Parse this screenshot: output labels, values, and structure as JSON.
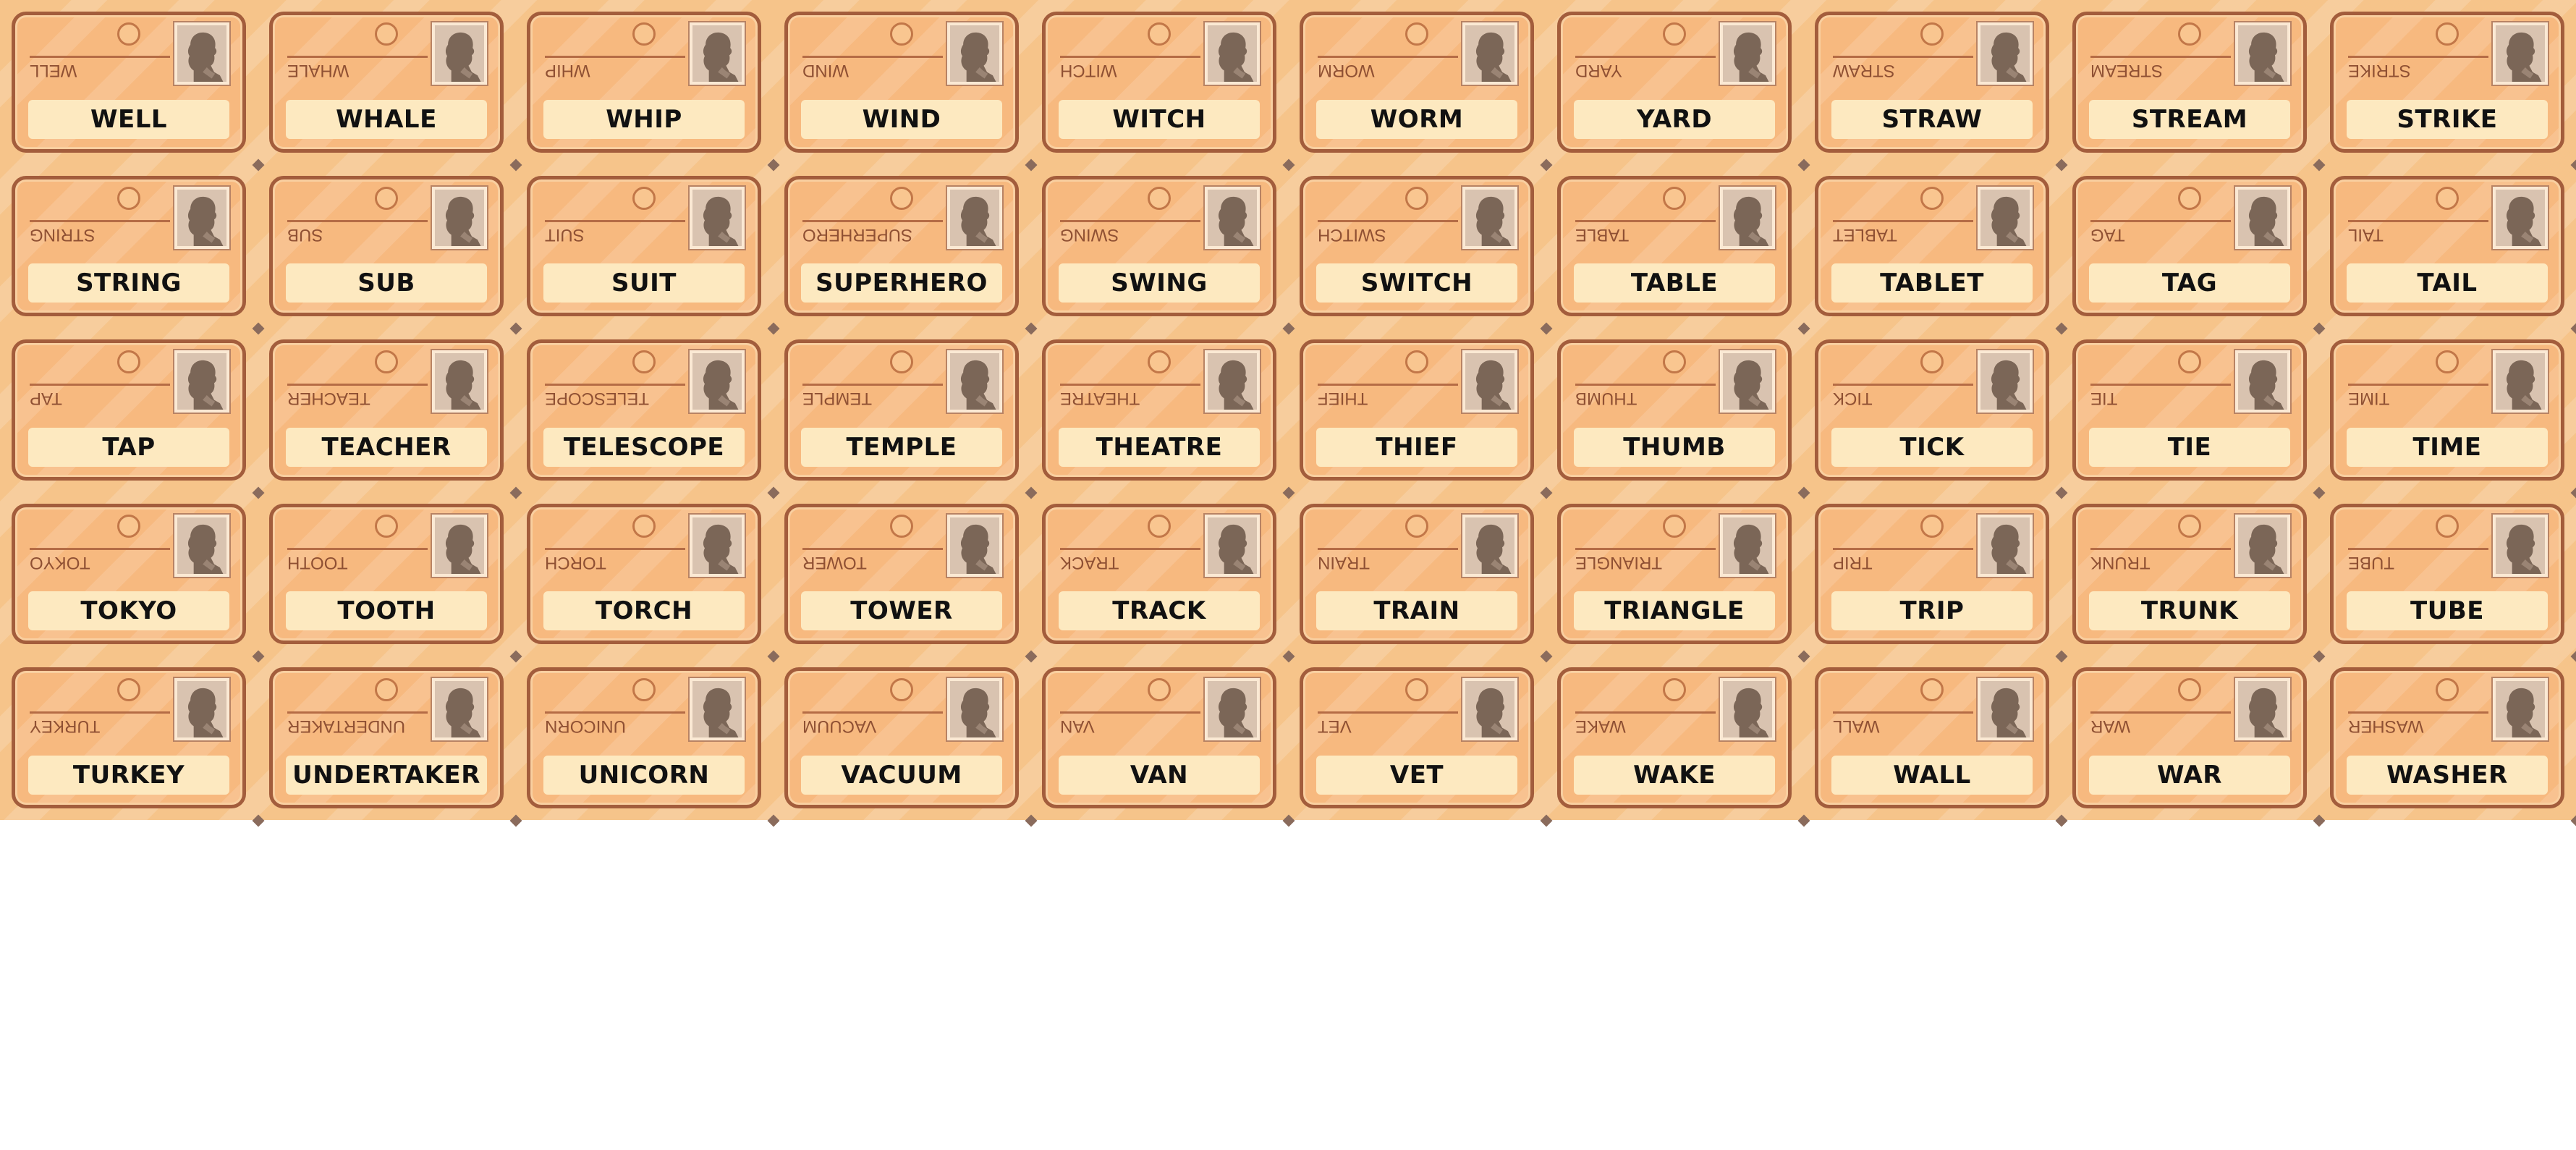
{
  "cards": [
    {
      "word": "WELL"
    },
    {
      "word": "WHALE"
    },
    {
      "word": "WHIP"
    },
    {
      "word": "WIND"
    },
    {
      "word": "WITCH"
    },
    {
      "word": "WORM"
    },
    {
      "word": "YARD"
    },
    {
      "word": "STRAW"
    },
    {
      "word": "STREAM"
    },
    {
      "word": "STRIKE"
    },
    {
      "word": "STRING"
    },
    {
      "word": "SUB"
    },
    {
      "word": "SUIT"
    },
    {
      "word": "SUPERHERO"
    },
    {
      "word": "SWING"
    },
    {
      "word": "SWITCH"
    },
    {
      "word": "TABLE"
    },
    {
      "word": "TABLET"
    },
    {
      "word": "TAG"
    },
    {
      "word": "TAIL"
    },
    {
      "word": "TAP"
    },
    {
      "word": "TEACHER"
    },
    {
      "word": "TELESCOPE"
    },
    {
      "word": "TEMPLE"
    },
    {
      "word": "THEATRE"
    },
    {
      "word": "THIEF"
    },
    {
      "word": "THUMB"
    },
    {
      "word": "TICK"
    },
    {
      "word": "TIE"
    },
    {
      "word": "TIME"
    },
    {
      "word": "TOKYO"
    },
    {
      "word": "TOOTH"
    },
    {
      "word": "TORCH"
    },
    {
      "word": "TOWER"
    },
    {
      "word": "TRACK"
    },
    {
      "word": "TRAIN"
    },
    {
      "word": "TRIANGLE"
    },
    {
      "word": "TRIP"
    },
    {
      "word": "TRUNK"
    },
    {
      "word": "TUBE"
    },
    {
      "word": "TURKEY"
    },
    {
      "word": "UNDERTAKER"
    },
    {
      "word": "UNICORN"
    },
    {
      "word": "VACUUM"
    },
    {
      "word": "VAN"
    },
    {
      "word": "VET"
    },
    {
      "word": "WAKE"
    },
    {
      "word": "WALL"
    },
    {
      "word": "WAR"
    },
    {
      "word": "WASHER"
    }
  ],
  "icons": {
    "portrait": "agent-silhouette-icon",
    "hole": "punch-hole-icon"
  },
  "colors": {
    "sheet_background": "#f6c48a",
    "card_fill": "#f7b97f",
    "card_border": "#a35d3c",
    "label_fill": "#fde9c0",
    "label_text": "#111111",
    "mirror_text": "#8f5033",
    "portrait_bg": "#d9c3b0",
    "silhouette": "#7b6657"
  }
}
